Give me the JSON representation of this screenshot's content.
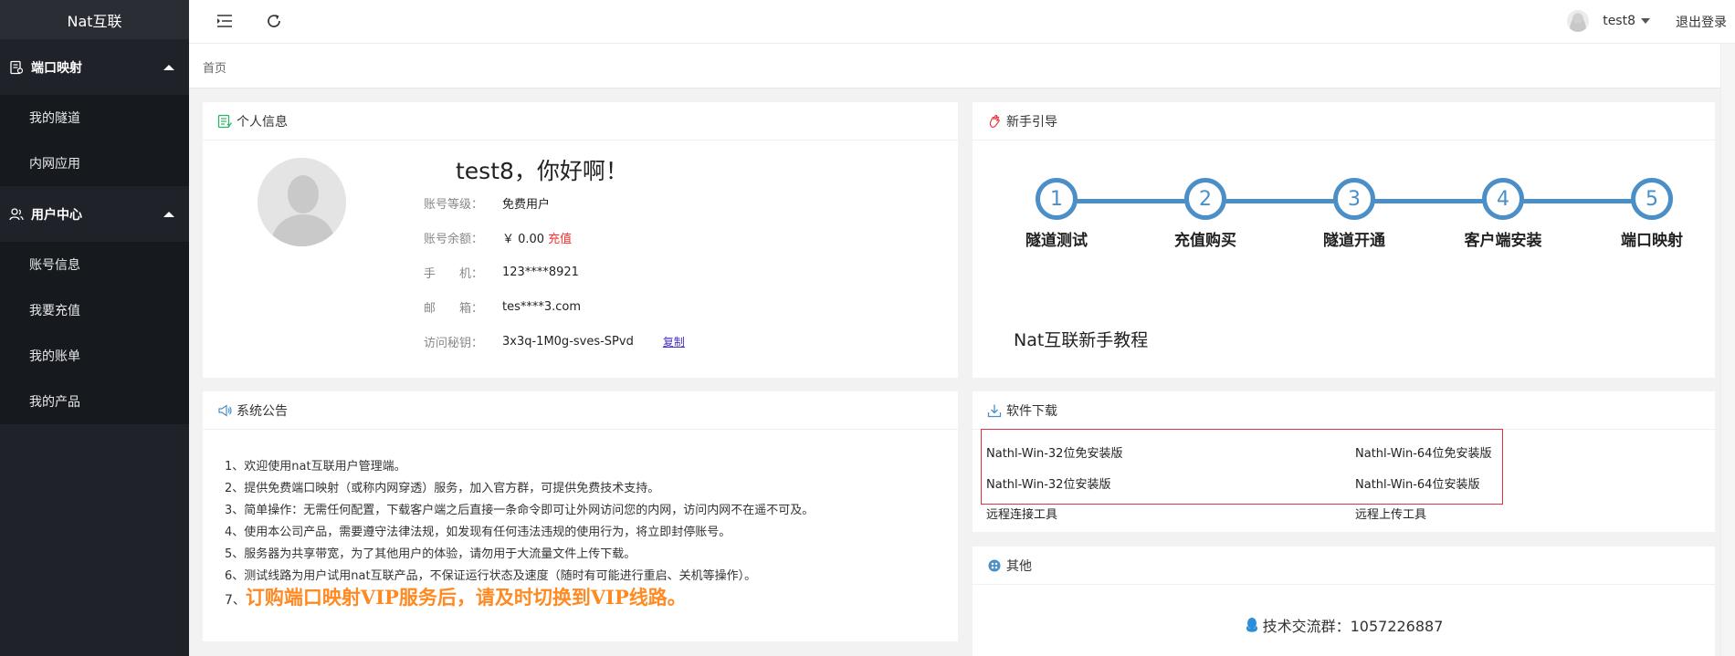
{
  "app": {
    "brand": "Nat互联"
  },
  "sidebar": {
    "groups": [
      {
        "label": "端口映射",
        "icon": "port-mapping-icon",
        "items": [
          "我的隧道",
          "内网应用"
        ]
      },
      {
        "label": "用户中心",
        "icon": "user-center-icon",
        "items": [
          "账号信息",
          "我要充值",
          "我的账单",
          "我的产品"
        ]
      }
    ]
  },
  "topbar": {
    "menu_toggle_icon": "menu-collapse-icon",
    "refresh_icon": "refresh-icon",
    "username": "test8",
    "logout": "退出登录"
  },
  "breadcrumb": {
    "home": "首页"
  },
  "profile": {
    "title": "个人信息",
    "greeting": "test8，你好啊！",
    "rows": {
      "level": {
        "label": "账号等级：",
        "value": "免费用户"
      },
      "balance": {
        "label": "账号余额：",
        "value": "￥ 0.00",
        "action": "充值"
      },
      "phone": {
        "label": "手　　机：",
        "value": "123****8921"
      },
      "email": {
        "label": "邮　　箱：",
        "value": "tes****3.com"
      },
      "secret": {
        "label": "访问秘钥：",
        "value": "3x3q-1M0g-sves-SPvd",
        "action": "复制"
      }
    }
  },
  "guide": {
    "title": "新手引导",
    "steps": [
      {
        "num": "1",
        "label": "隧道测试"
      },
      {
        "num": "2",
        "label": "充值购买"
      },
      {
        "num": "3",
        "label": "隧道开通"
      },
      {
        "num": "4",
        "label": "客户端安装"
      },
      {
        "num": "5",
        "label": "端口映射"
      }
    ],
    "tutorial": "Nat互联新手教程",
    "accent_color": "#4a8fc7"
  },
  "announcements": {
    "title": "系统公告",
    "items": [
      "1、欢迎使用nat互联用户管理端。",
      "2、提供免费端口映射（或称内网穿透）服务，加入官方群，可提供免费技术支持。",
      "3、简单操作：无需任何配置，下载客户端之后直接一条命令即可让外网访问您的内网，访问内网不在遥不可及。",
      "4、使用本公司产品，需要遵守法律法规，如发现有任何违法违规的使用行为，将立即封停账号。",
      "5、服务器为共享带宽，为了其他用户的体验，请勿用于大流量文件上传下载。",
      "6、测试线路为用户试用nat互联产品，不保证运行状态及速度（随时有可能进行重启、关机等操作）。"
    ],
    "highlight_num": "7、",
    "highlight_text": "订购端口映射VIP服务后，请及时切换到VIP线路。",
    "highlight_color": "#ff8a22"
  },
  "downloads": {
    "title": "软件下载",
    "links": {
      "win32_portable": "Nathl-Win-32位免安装版",
      "win64_portable": "Nathl-Win-64位免安装版",
      "win32_installer": "Nathl-Win-32位安装版",
      "win64_installer": "Nathl-Win-64位安装版",
      "remote_tool": "远程连接工具",
      "remote_upload": "远程上传工具"
    },
    "highlight_border_color": "#e8303a"
  },
  "other": {
    "title": "其他",
    "qq_group": "技术交流群：1057226887"
  }
}
